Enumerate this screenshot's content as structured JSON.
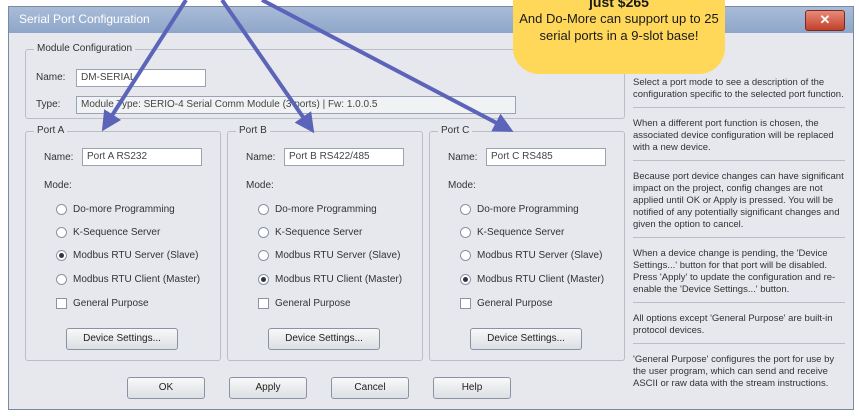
{
  "window": {
    "title": "Serial Port Configuration",
    "close_glyph": "✕"
  },
  "module": {
    "legend": "Module Configuration",
    "name_label": "Name:",
    "name_value": "DM-SERIAL",
    "type_label": "Type:",
    "type_value": "Module Type: SERIO-4 Serial Comm Module (3 ports)  |  Fw: 1.0.0.5"
  },
  "ports": [
    {
      "legend": "Port A",
      "name_label": "Name:",
      "name_value": "Port A RS232",
      "mode_label": "Mode:",
      "options": [
        "Do-more Programming",
        "K-Sequence Server",
        "Modbus RTU Server (Slave)",
        "Modbus RTU Client (Master)",
        "General Purpose"
      ],
      "selected": 2,
      "settings_button": "Device Settings..."
    },
    {
      "legend": "Port B",
      "name_label": "Name:",
      "name_value": "Port B RS422/485",
      "mode_label": "Mode:",
      "options": [
        "Do-more Programming",
        "K-Sequence Server",
        "Modbus RTU Server (Slave)",
        "Modbus RTU Client (Master)",
        "General Purpose"
      ],
      "selected": 3,
      "settings_button": "Device Settings..."
    },
    {
      "legend": "Port C",
      "name_label": "Name:",
      "name_value": "Port C RS485",
      "mode_label": "Mode:",
      "options": [
        "Do-more Programming",
        "K-Sequence Server",
        "Modbus RTU Server (Slave)",
        "Modbus RTU Client (Master)",
        "General Purpose"
      ],
      "selected": 3,
      "settings_button": "Device Settings..."
    }
  ],
  "info": [
    "Select a port mode to see a description of the configuration specific to the selected port function.",
    "When a different port function is chosen, the associated device configuration will be replaced with a new device.",
    "Because port device changes can have significant impact on the project, config changes are not applied until OK or Apply is pressed. You will be notified of any potentially significant changes and given the option to cancel.",
    "When a device change is pending, the 'Device Settings...' button for that port will be disabled. Press 'Apply' to update the configuration and re-enable the 'Device Settings...' button.",
    "All options except 'General Purpose' are built-in protocol devices.",
    "'General Purpose' configures the port for use by the user program, which can send and receive ASCII or raw data with the stream instructions."
  ],
  "buttons": {
    "ok": "OK",
    "apply": "Apply",
    "cancel": "Cancel",
    "help": "Help"
  },
  "callout": {
    "price": "just $265",
    "text": "And Do-More can support up to 25 serial ports in a 9-slot base!",
    "color": "#ffd85a"
  },
  "colors": {
    "arrow": "#5b64b8",
    "window_bg": "#e6e8ed",
    "titlebar": "#8ea6c9"
  }
}
